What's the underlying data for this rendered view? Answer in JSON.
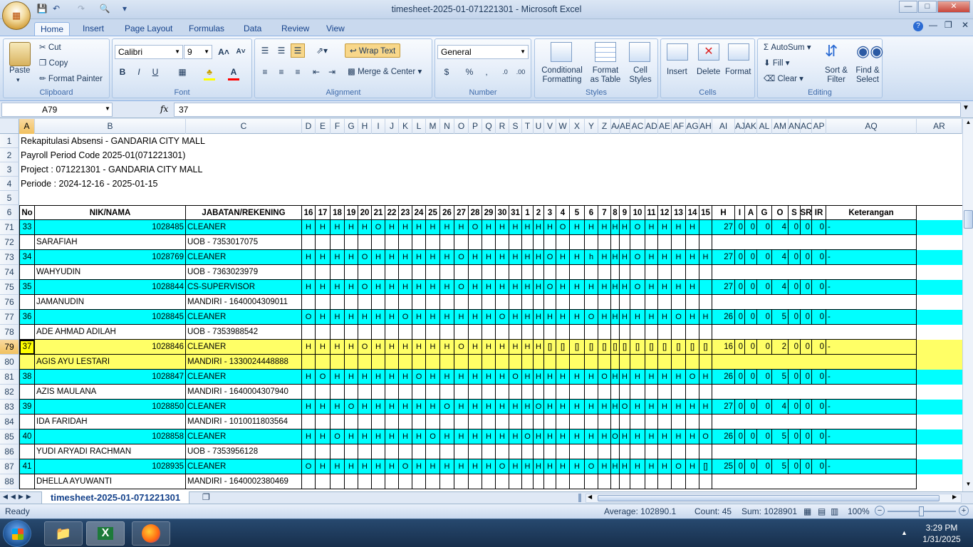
{
  "window": {
    "title": "timesheet-2025-01-071221301 - Microsoft Excel"
  },
  "tabs": [
    "Home",
    "Insert",
    "Page Layout",
    "Formulas",
    "Data",
    "Review",
    "View"
  ],
  "ribbon": {
    "clipboard": {
      "label": "Clipboard",
      "paste": "Paste",
      "cut": "Cut",
      "copy": "Copy",
      "format_painter": "Format Painter"
    },
    "font": {
      "label": "Font",
      "name": "Calibri",
      "size": "9"
    },
    "alignment": {
      "label": "Alignment",
      "wrap_text": "Wrap Text",
      "merge_center": "Merge & Center"
    },
    "number": {
      "label": "Number",
      "format": "General"
    },
    "styles": {
      "label": "Styles",
      "conditional": "Conditional\nFormatting",
      "format_table": "Format\nas Table",
      "cell_styles": "Cell\nStyles"
    },
    "cells": {
      "label": "Cells",
      "insert": "Insert",
      "delete": "Delete",
      "format": "Format"
    },
    "editing": {
      "label": "Editing",
      "autosum": "AutoSum",
      "fill": "Fill",
      "clear": "Clear",
      "sort_filter": "Sort &\nFilter",
      "find_select": "Find &\nSelect"
    }
  },
  "formula_bar": {
    "name_box": "A79",
    "fx": "fx",
    "value": "37"
  },
  "columns": [
    "A",
    "B",
    "C",
    "D",
    "E",
    "F",
    "G",
    "H",
    "I",
    "J",
    "K",
    "L",
    "M",
    "N",
    "O",
    "P",
    "Q",
    "R",
    "S",
    "T",
    "U",
    "V",
    "W",
    "X",
    "Y",
    "Z",
    "AA",
    "AB",
    "AC",
    "AD",
    "AE",
    "AF",
    "AG",
    "AH",
    "AI",
    "AJ",
    "AK",
    "AL",
    "AM",
    "AN",
    "AO",
    "AP",
    "AQ",
    "AR"
  ],
  "header_rows": [
    {
      "num": "1",
      "text": "Rekapitulasi Absensi - GANDARIA CITY MALL"
    },
    {
      "num": "2",
      "text": "Payroll Period Code 2025-01(071221301)"
    },
    {
      "num": "3",
      "text": "Project : 071221301 - GANDARIA CITY MALL"
    },
    {
      "num": "4",
      "text": "Periode : 2024-12-16 - 2025-01-15"
    },
    {
      "num": "5",
      "text": ""
    }
  ],
  "table_header": {
    "num": "6",
    "cols": [
      "No",
      "NIK/NAMA",
      "JABATAN/REKENING",
      "16",
      "17",
      "18",
      "19",
      "20",
      "21",
      "22",
      "23",
      "24",
      "25",
      "26",
      "27",
      "28",
      "29",
      "30",
      "31",
      "1",
      "2",
      "3",
      "4",
      "5",
      "6",
      "7",
      "8",
      "9",
      "10",
      "11",
      "12",
      "13",
      "14",
      "15",
      "H",
      "I",
      "A",
      "G",
      "O",
      "S",
      "SR",
      "IR",
      "Keterangan"
    ]
  },
  "employees": [
    {
      "r1": "71",
      "r2": "72",
      "no": "33",
      "nik": "1028485",
      "jab": "CLEANER",
      "nama": "SARAFIAH",
      "rek": "UOB - 7353017075",
      "days": "HHHHHOHHHHHHOHHHHHHOHHHHHOHHHH",
      "h": "27",
      "i": "0",
      "a": "0",
      "g": "0",
      "o": "4",
      "s": "0",
      "sr": "0",
      "ir": "0",
      "ket": "-"
    },
    {
      "r1": "73",
      "r2": "74",
      "no": "34",
      "nik": "1028769",
      "jab": "CLEANER",
      "nama": "WAHYUDIN",
      "rek": "UOB - 7363023979",
      "days": "HHHHOHHHHHHOHHHHHHOHHhHHHOHHHHHH",
      "h": "27",
      "i": "0",
      "a": "0",
      "g": "0",
      "o": "4",
      "s": "0",
      "sr": "0",
      "ir": "0",
      "ket": "-"
    },
    {
      "r1": "75",
      "r2": "76",
      "no": "35",
      "nik": "1028844",
      "jab": "CS-SUPERVISOR",
      "nama": "JAMANUDIN",
      "rek": "MANDIRI - 1640004309011",
      "days": "HHHHOHHHHHHOHHHHHHOHHHHHHOHHHH",
      "h": "27",
      "i": "0",
      "a": "0",
      "g": "0",
      "o": "4",
      "s": "0",
      "sr": "0",
      "ir": "0",
      "ket": "-"
    },
    {
      "r1": "77",
      "r2": "78",
      "no": "36",
      "nik": "1028845",
      "jab": "CLEANER",
      "nama": "ADE AHMAD ADILAH",
      "rek": "UOB - 7353988542",
      "days": "OHHHHHHOHHHHHHOHHHHHHOHHHHHHOHH",
      "h": "26",
      "i": "0",
      "a": "0",
      "g": "0",
      "o": "5",
      "s": "0",
      "sr": "0",
      "ir": "0",
      "ket": "-"
    },
    {
      "r1": "79",
      "r2": "80",
      "no": "37",
      "nik": "1028846",
      "jab": "CLEANER",
      "nama": "AGIS AYU LESTARI",
      "rek": "MANDIRI - 1330024448888",
      "days": "HHHHOHHHHHHOHHHHHH[][][][][][][][][][][][][]",
      "h": "16",
      "i": "0",
      "a": "0",
      "g": "0",
      "o": "2",
      "s": "0",
      "sr": "0",
      "ir": "0",
      "ket": "-",
      "selected": true
    },
    {
      "r1": "81",
      "r2": "82",
      "no": "38",
      "nik": "1028847",
      "jab": "CLEANER",
      "nama": "AZIS MAULANA",
      "rek": "MANDIRI - 1640004307940",
      "days": "HOHHHHHHOHHHHHHOHHHHHHOHHHHHHOH",
      "h": "26",
      "i": "0",
      "a": "0",
      "g": "0",
      "o": "5",
      "s": "0",
      "sr": "0",
      "ir": "0",
      "ket": "-"
    },
    {
      "r1": "83",
      "r2": "84",
      "no": "39",
      "nik": "1028850",
      "jab": "CLEANER",
      "nama": "IDA FARIDAH",
      "rek": "MANDIRI - 1010011803564",
      "days": "HHHOHHHHHHOHHHHHHOHHHHHHOHHHHHH",
      "h": "27",
      "i": "0",
      "a": "0",
      "g": "0",
      "o": "4",
      "s": "0",
      "sr": "0",
      "ir": "0",
      "ket": "-"
    },
    {
      "r1": "85",
      "r2": "86",
      "no": "40",
      "nik": "1028858",
      "jab": "CLEANER",
      "nama": "YUDI ARYADI RACHMAN",
      "rek": "UOB - 7353956128",
      "days": "HHOHHHHHHOHHHHHHOHHHHHHOHHHHHHO",
      "h": "26",
      "i": "0",
      "a": "0",
      "g": "0",
      "o": "5",
      "s": "0",
      "sr": "0",
      "ir": "0",
      "ket": "-"
    },
    {
      "r1": "87",
      "r2": "88",
      "no": "41",
      "nik": "1028935",
      "jab": "CLEANER",
      "nama": "DHELLA AYUWANTI",
      "rek": "MANDIRI - 1640002380469",
      "days": "OHHHHHHOHHHHHHOHHHHHHOHHHHHHOH[]",
      "h": "25",
      "i": "0",
      "a": "0",
      "g": "0",
      "o": "5",
      "s": "0",
      "sr": "0",
      "ir": "0",
      "ket": "-"
    }
  ],
  "sheet_tab": "timesheet-2025-01-071221301",
  "status": {
    "ready": "Ready",
    "average": "Average: 102890.1",
    "count": "Count: 45",
    "sum": "Sum: 1028901",
    "zoom": "100%"
  },
  "clock": {
    "time": "3:29 PM",
    "date": "1/31/2025"
  }
}
